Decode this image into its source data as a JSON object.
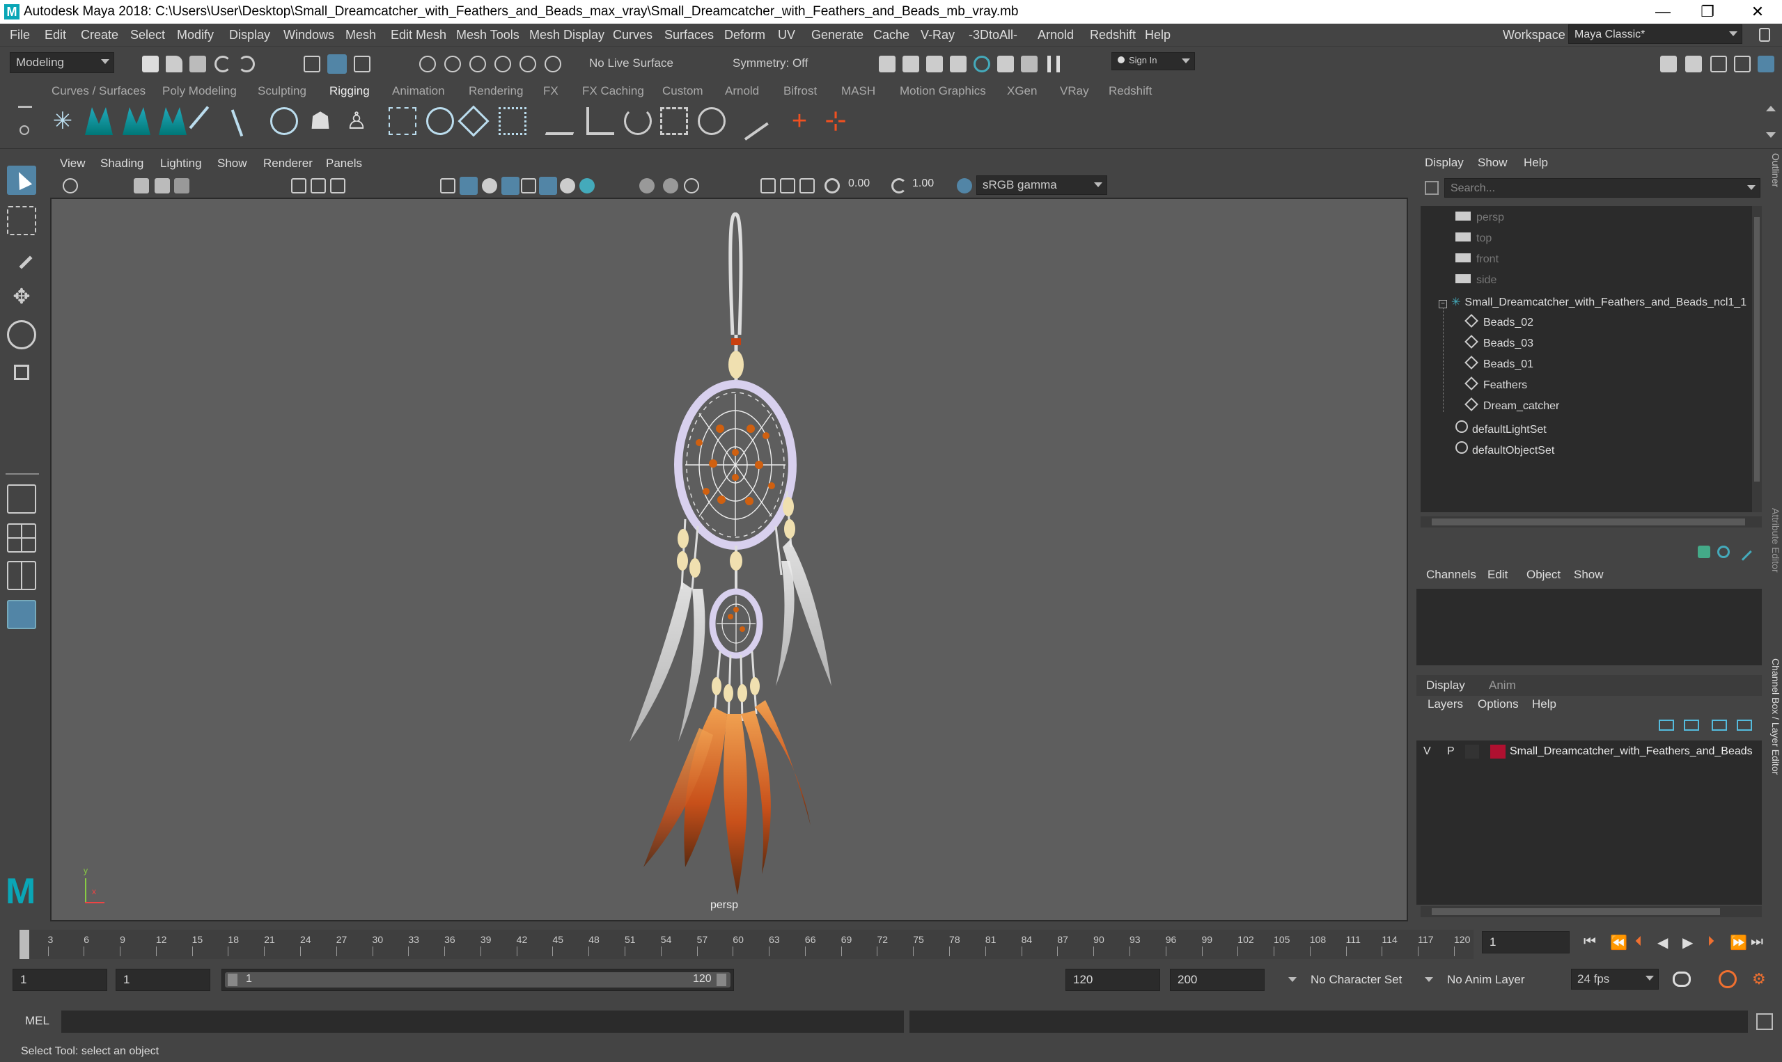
{
  "window": {
    "title": "Autodesk Maya 2018: C:\\Users\\User\\Desktop\\Small_Dreamcatcher_with_Feathers_and_Beads_max_vray\\Small_Dreamcatcher_with_Feathers_and_Beads_mb_vray.mb",
    "logo": "M",
    "minimize": "—",
    "maximize": "❐",
    "close": "✕"
  },
  "menu": [
    "File",
    "Edit",
    "Create",
    "Select",
    "Modify",
    "Display",
    "Windows",
    "Mesh",
    "Edit Mesh",
    "Mesh Tools",
    "Mesh Display",
    "Curves",
    "Surfaces",
    "Deform",
    "UV",
    "Generate",
    "Cache",
    "V-Ray",
    "-3DtoAll-",
    "Arnold",
    "Redshift",
    "Help"
  ],
  "workspace": {
    "label": "Workspace :",
    "value": "Maya Classic*"
  },
  "status": {
    "mode": "Modeling",
    "live_surface": "No Live Surface",
    "symmetry": "Symmetry: Off",
    "sign_in": "Sign In"
  },
  "shelf_tabs": [
    "Curves / Surfaces",
    "Poly Modeling",
    "Sculpting",
    "Rigging",
    "Animation",
    "Rendering",
    "FX",
    "FX Caching",
    "Custom",
    "Arnold",
    "Bifrost",
    "MASH",
    "Motion Graphics",
    "XGen",
    "VRay",
    "Redshift"
  ],
  "shelf_active": "Rigging",
  "viewport": {
    "menu": [
      "View",
      "Shading",
      "Lighting",
      "Show",
      "Renderer",
      "Panels"
    ],
    "exposure": "0.00",
    "gamma": "1.00",
    "color_space": "sRGB gamma",
    "camera_label": "persp",
    "axis_x": "x",
    "axis_y": "y",
    "maya_logo": "M"
  },
  "outliner": {
    "menu": [
      "Display",
      "Show",
      "Help"
    ],
    "search_placeholder": "Search...",
    "items": [
      {
        "label": "persp",
        "type": "camera",
        "dim": true
      },
      {
        "label": "top",
        "type": "camera",
        "dim": true
      },
      {
        "label": "front",
        "type": "camera",
        "dim": true
      },
      {
        "label": "side",
        "type": "camera",
        "dim": true
      },
      {
        "label": "Small_Dreamcatcher_with_Feathers_and_Beads_ncl1_1",
        "type": "group",
        "dim": false
      },
      {
        "label": "Beads_02",
        "type": "mesh",
        "dim": false
      },
      {
        "label": "Beads_03",
        "type": "mesh",
        "dim": false
      },
      {
        "label": "Beads_01",
        "type": "mesh",
        "dim": false
      },
      {
        "label": "Feathers",
        "type": "mesh",
        "dim": false
      },
      {
        "label": "Dream_catcher",
        "type": "mesh",
        "dim": false
      },
      {
        "label": "defaultLightSet",
        "type": "set",
        "dim": false
      },
      {
        "label": "defaultObjectSet",
        "type": "set",
        "dim": false
      }
    ]
  },
  "side_tabs": {
    "outliner": "Outliner",
    "attribute_editor": "Attribute Editor",
    "channel_box": "Channel Box / Layer Editor"
  },
  "channel_box": {
    "menu": [
      "Channels",
      "Edit",
      "Object",
      "Show"
    ]
  },
  "layer_editor": {
    "tabs": [
      "Display",
      "Anim"
    ],
    "menu": [
      "Layers",
      "Options",
      "Help"
    ],
    "layer": {
      "v": "V",
      "p": "P",
      "name": "Small_Dreamcatcher_with_Feathers_and_Beads",
      "color": "#b01030"
    }
  },
  "timeline": {
    "ticks": [
      "1",
      "3",
      "6",
      "9",
      "12",
      "15",
      "18",
      "21",
      "24",
      "27",
      "30",
      "33",
      "36",
      "39",
      "42",
      "45",
      "48",
      "51",
      "54",
      "57",
      "60",
      "63",
      "66",
      "69",
      "72",
      "75",
      "78",
      "81",
      "84",
      "87",
      "90",
      "93",
      "96",
      "99",
      "102",
      "105",
      "108",
      "111",
      "114",
      "117",
      "120"
    ],
    "current_frame": "1",
    "current": 1,
    "min": 1,
    "max": 120
  },
  "range": {
    "start": "1",
    "playback_start": "1",
    "slider_start": "1",
    "slider_end": "120",
    "playback_end": "120",
    "end": "200",
    "character_set": "No Character Set",
    "anim_layer": "No Anim Layer",
    "fps": "24 fps"
  },
  "command_line": {
    "label": "MEL"
  },
  "help_line": "Select Tool: select an object",
  "colors": {
    "accent": "#5285a6",
    "maya_teal": "#0aa6b6",
    "panel": "#444444",
    "field": "#2b2b2b",
    "viewport": "#5e5e5e"
  }
}
